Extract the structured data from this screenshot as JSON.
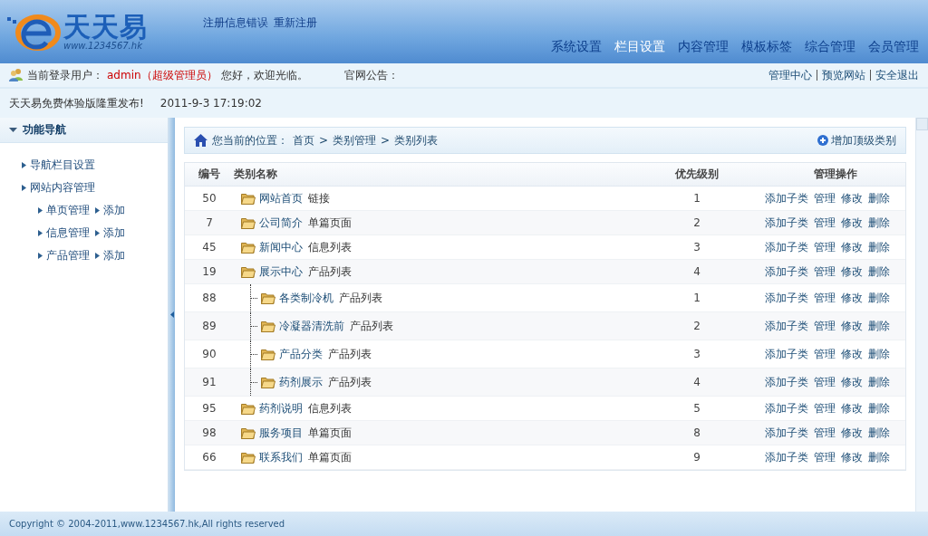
{
  "logo": {
    "name": "天天易",
    "url": "www.1234567.hk"
  },
  "header_links": [
    "注册信息错误",
    "重新注册"
  ],
  "nav": [
    {
      "label": "系统设置",
      "selected": false
    },
    {
      "label": "栏目设置",
      "selected": true
    },
    {
      "label": "内容管理",
      "selected": false
    },
    {
      "label": "模板标签",
      "selected": false
    },
    {
      "label": "综合管理",
      "selected": false
    },
    {
      "label": "会员管理",
      "selected": false
    }
  ],
  "user_bar": {
    "label": "当前登录用户：",
    "user": "admin（超级管理员）",
    "greeting": "您好，欢迎光临。",
    "notice_label": "官网公告：",
    "links": [
      "管理中心",
      "预览网站",
      "安全退出"
    ]
  },
  "announcement": {
    "text": "天天易免费体验版隆重发布!",
    "time": "2011-9-3 17:19:02"
  },
  "sidebar": {
    "title": "功能导航",
    "expanded": true,
    "items": [
      {
        "label": "导航栏目设置"
      },
      {
        "label": "网站内容管理",
        "children": [
          {
            "label": "单页管理",
            "action": "添加"
          },
          {
            "label": "信息管理",
            "action": "添加"
          },
          {
            "label": "产品管理",
            "action": "添加"
          }
        ]
      }
    ]
  },
  "breadcrumb": {
    "label": "您当前的位置：",
    "items": [
      "首页",
      "类别管理",
      "类别列表"
    ],
    "separator": ">",
    "add_button": "增加顶级类别"
  },
  "table": {
    "columns": [
      "编号",
      "类别名称",
      "优先级别",
      "管理操作"
    ],
    "rows": [
      {
        "id": "50",
        "name": "网站首页",
        "type": "链接",
        "priority": "1",
        "actions": [
          "添加子类",
          "管理",
          "修改",
          "删除"
        ]
      },
      {
        "id": "7",
        "name": "公司简介",
        "type": "单篇页面",
        "priority": "2",
        "actions": [
          "添加子类",
          "管理",
          "修改",
          "删除"
        ]
      },
      {
        "id": "45",
        "name": "新闻中心",
        "type": "信息列表",
        "priority": "3",
        "actions": [
          "添加子类",
          "管理",
          "修改",
          "删除"
        ]
      },
      {
        "id": "19",
        "name": "展示中心",
        "type": "产品列表",
        "priority": "4",
        "actions": [
          "添加子类",
          "管理",
          "修改",
          "删除"
        ],
        "children": [
          {
            "id": "88",
            "name": "各类制冷机",
            "type": "产品列表",
            "priority": "1",
            "actions": [
              "添加子类",
              "管理",
              "修改",
              "删除"
            ]
          },
          {
            "id": "89",
            "name": "冷凝器清洗前",
            "type": "产品列表",
            "priority": "2",
            "actions": [
              "添加子类",
              "管理",
              "修改",
              "删除"
            ]
          },
          {
            "id": "90",
            "name": "产品分类",
            "type": "产品列表",
            "priority": "3",
            "actions": [
              "添加子类",
              "管理",
              "修改",
              "删除"
            ]
          },
          {
            "id": "91",
            "name": "药剂展示",
            "type": "产品列表",
            "priority": "4",
            "actions": [
              "添加子类",
              "管理",
              "修改",
              "删除"
            ]
          }
        ]
      },
      {
        "id": "95",
        "name": "药剂说明",
        "type": "信息列表",
        "priority": "5",
        "actions": [
          "添加子类",
          "管理",
          "修改",
          "删除"
        ]
      },
      {
        "id": "98",
        "name": "服务项目",
        "type": "单篇页面",
        "priority": "8",
        "actions": [
          "添加子类",
          "管理",
          "修改",
          "删除"
        ]
      },
      {
        "id": "66",
        "name": "联系我们",
        "type": "单篇页面",
        "priority": "9",
        "actions": [
          "添加子类",
          "管理",
          "修改",
          "删除"
        ]
      }
    ]
  },
  "footer": "Copyright © 2004-2011,www.1234567.hk,All rights reserved"
}
